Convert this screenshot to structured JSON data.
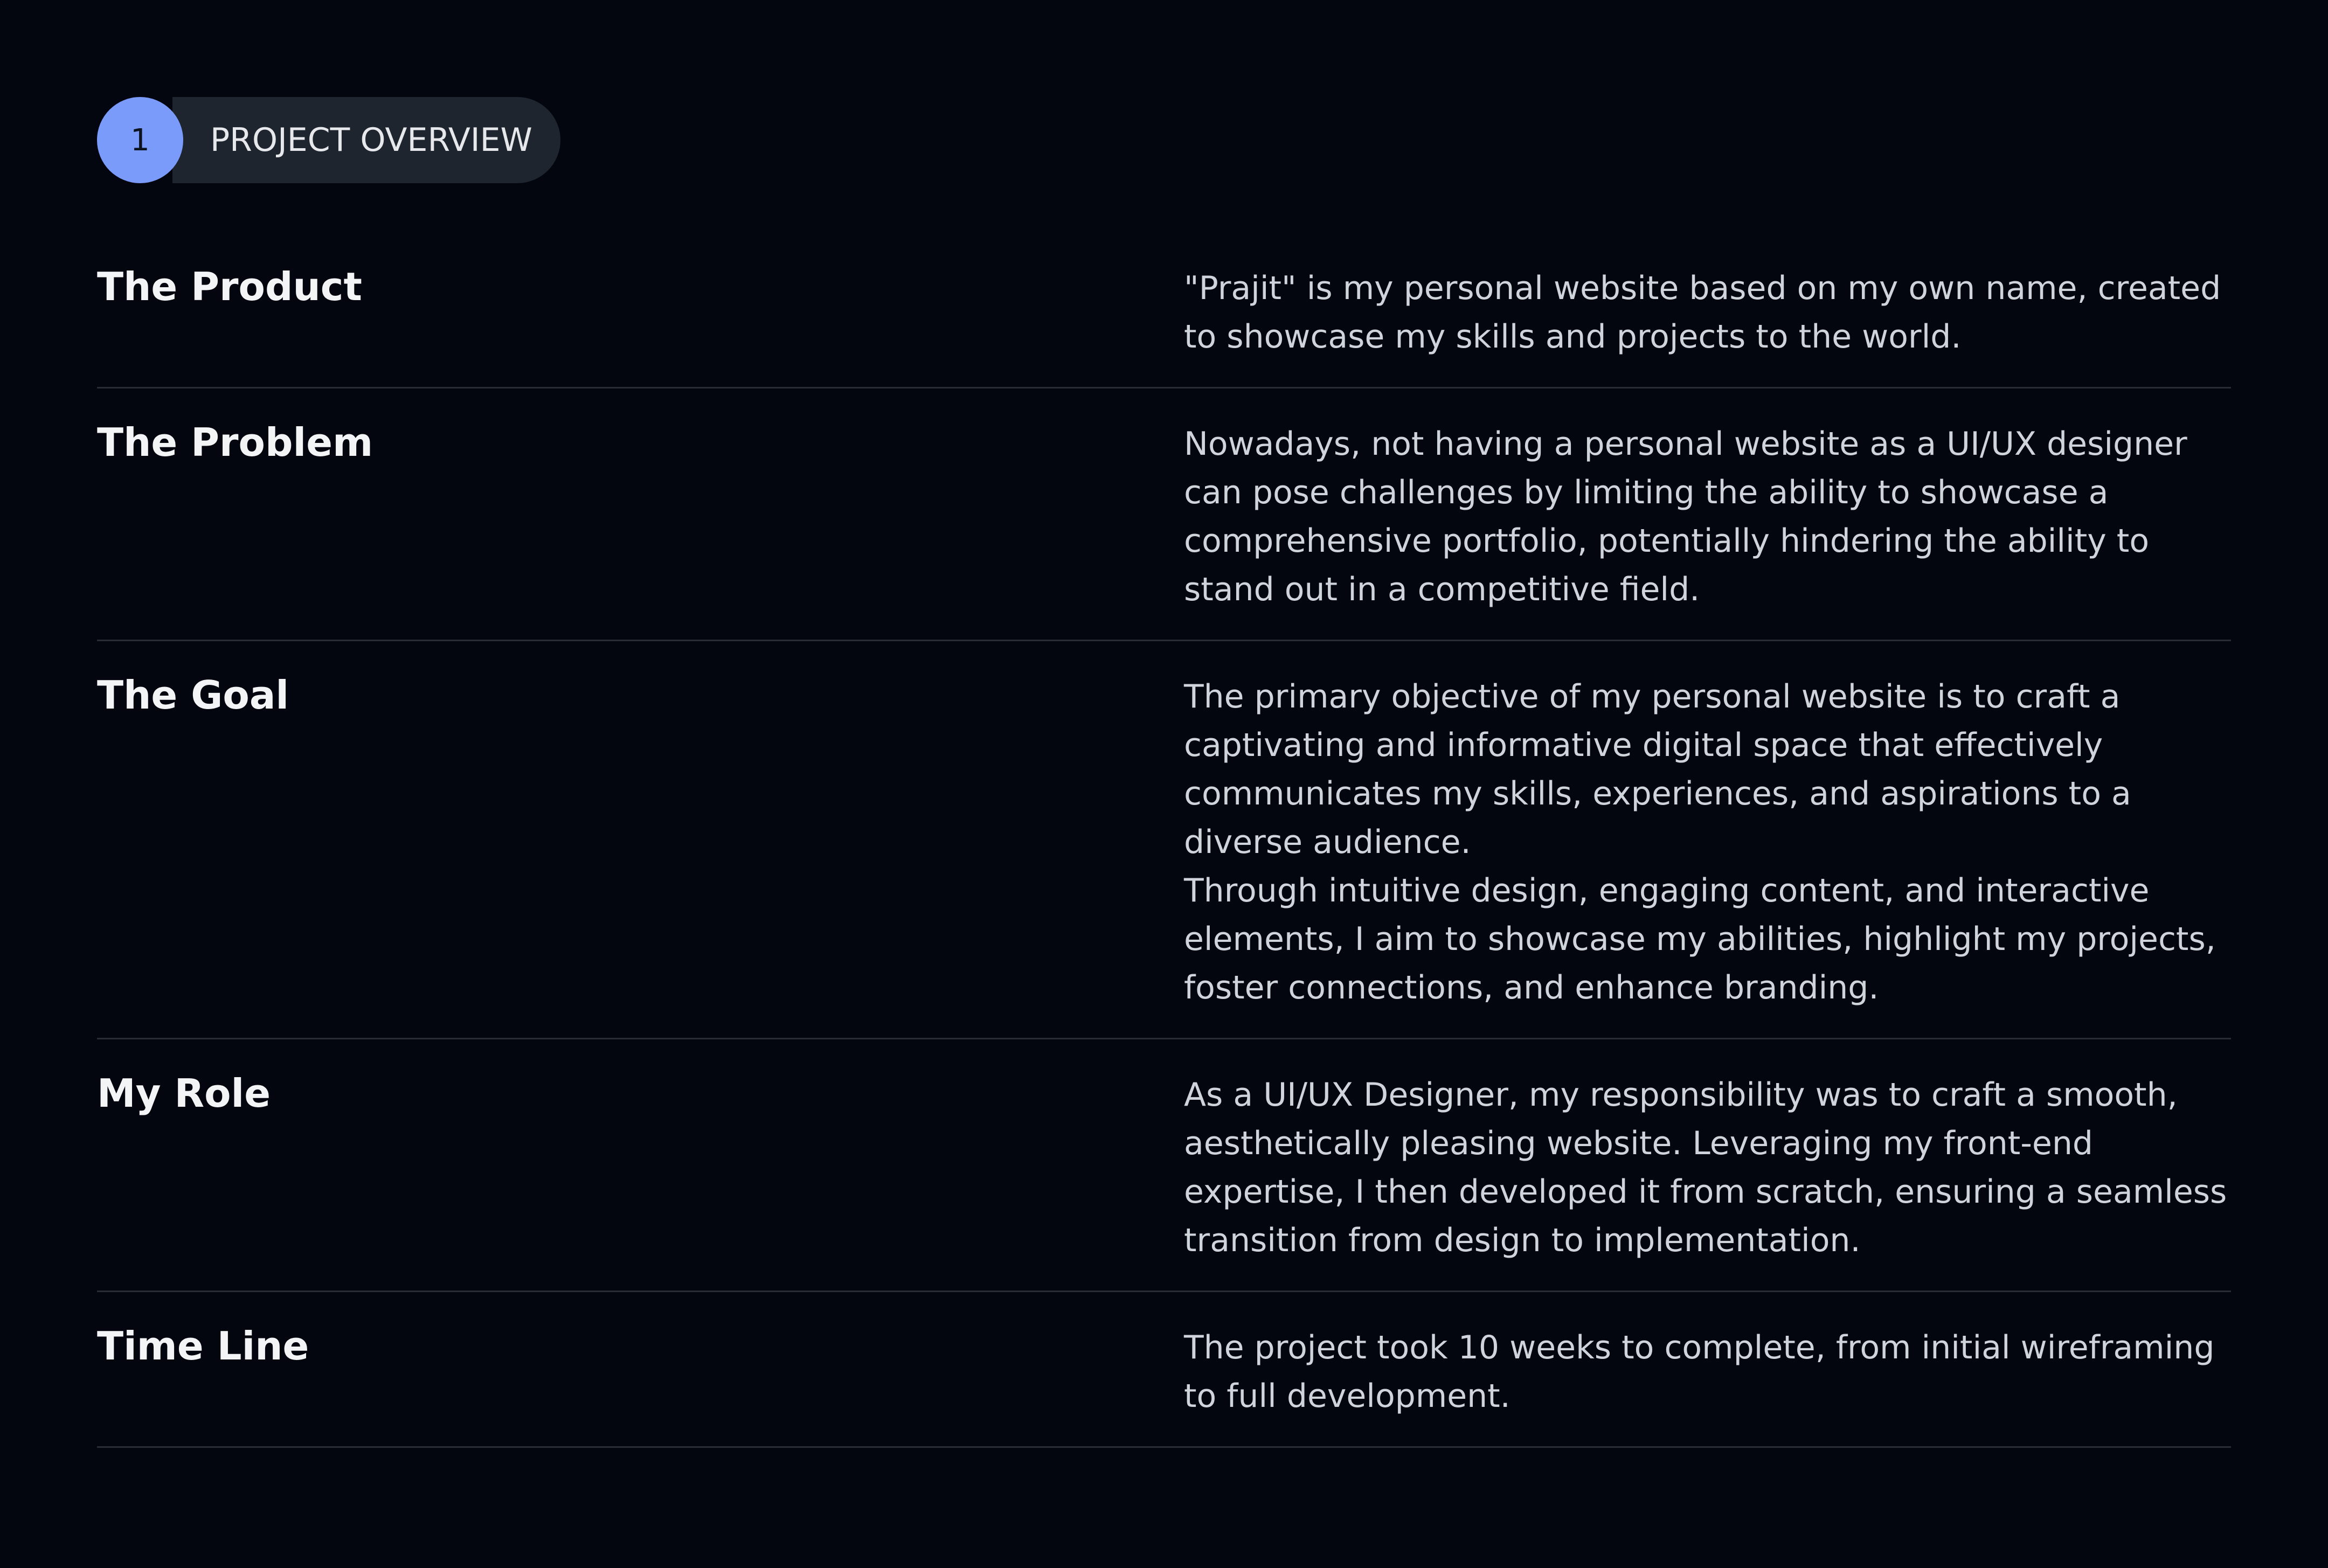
{
  "section": {
    "number": "1",
    "title": "PROJECT OVERVIEW"
  },
  "rows": [
    {
      "title": "The Product",
      "text": "\"Prajit\" is my personal website based on my own name, created to showcase my skills and projects to the world."
    },
    {
      "title": "The Problem",
      "text": "Nowadays, not having a personal website as a UI/UX designer can pose challenges by limiting the ability to showcase a comprehensive portfolio, potentially hindering the ability to stand out in a competitive field."
    },
    {
      "title": "The Goal",
      "text": "The primary objective of my personal website is to craft a captivating and informative digital space that effectively communicates my skills, experiences, and aspirations to a diverse audience.\nThrough intuitive design, engaging content, and interactive elements, I aim to showcase my abilities, highlight my projects, foster connections, and enhance branding."
    },
    {
      "title": "My Role",
      "text": "As a UI/UX Designer, my responsibility was to craft a smooth, aesthetically pleasing website. Leveraging my front-end expertise, I then developed it from scratch, ensuring a seamless transition from design to implementation."
    },
    {
      "title": "Time Line",
      "text": "The project took 10 weeks to complete, from initial wireframing to full development."
    }
  ],
  "colors": {
    "background": "#03060f",
    "accent": "#7b9bfb",
    "pill": "#1f252e",
    "divider": "#272c35"
  }
}
